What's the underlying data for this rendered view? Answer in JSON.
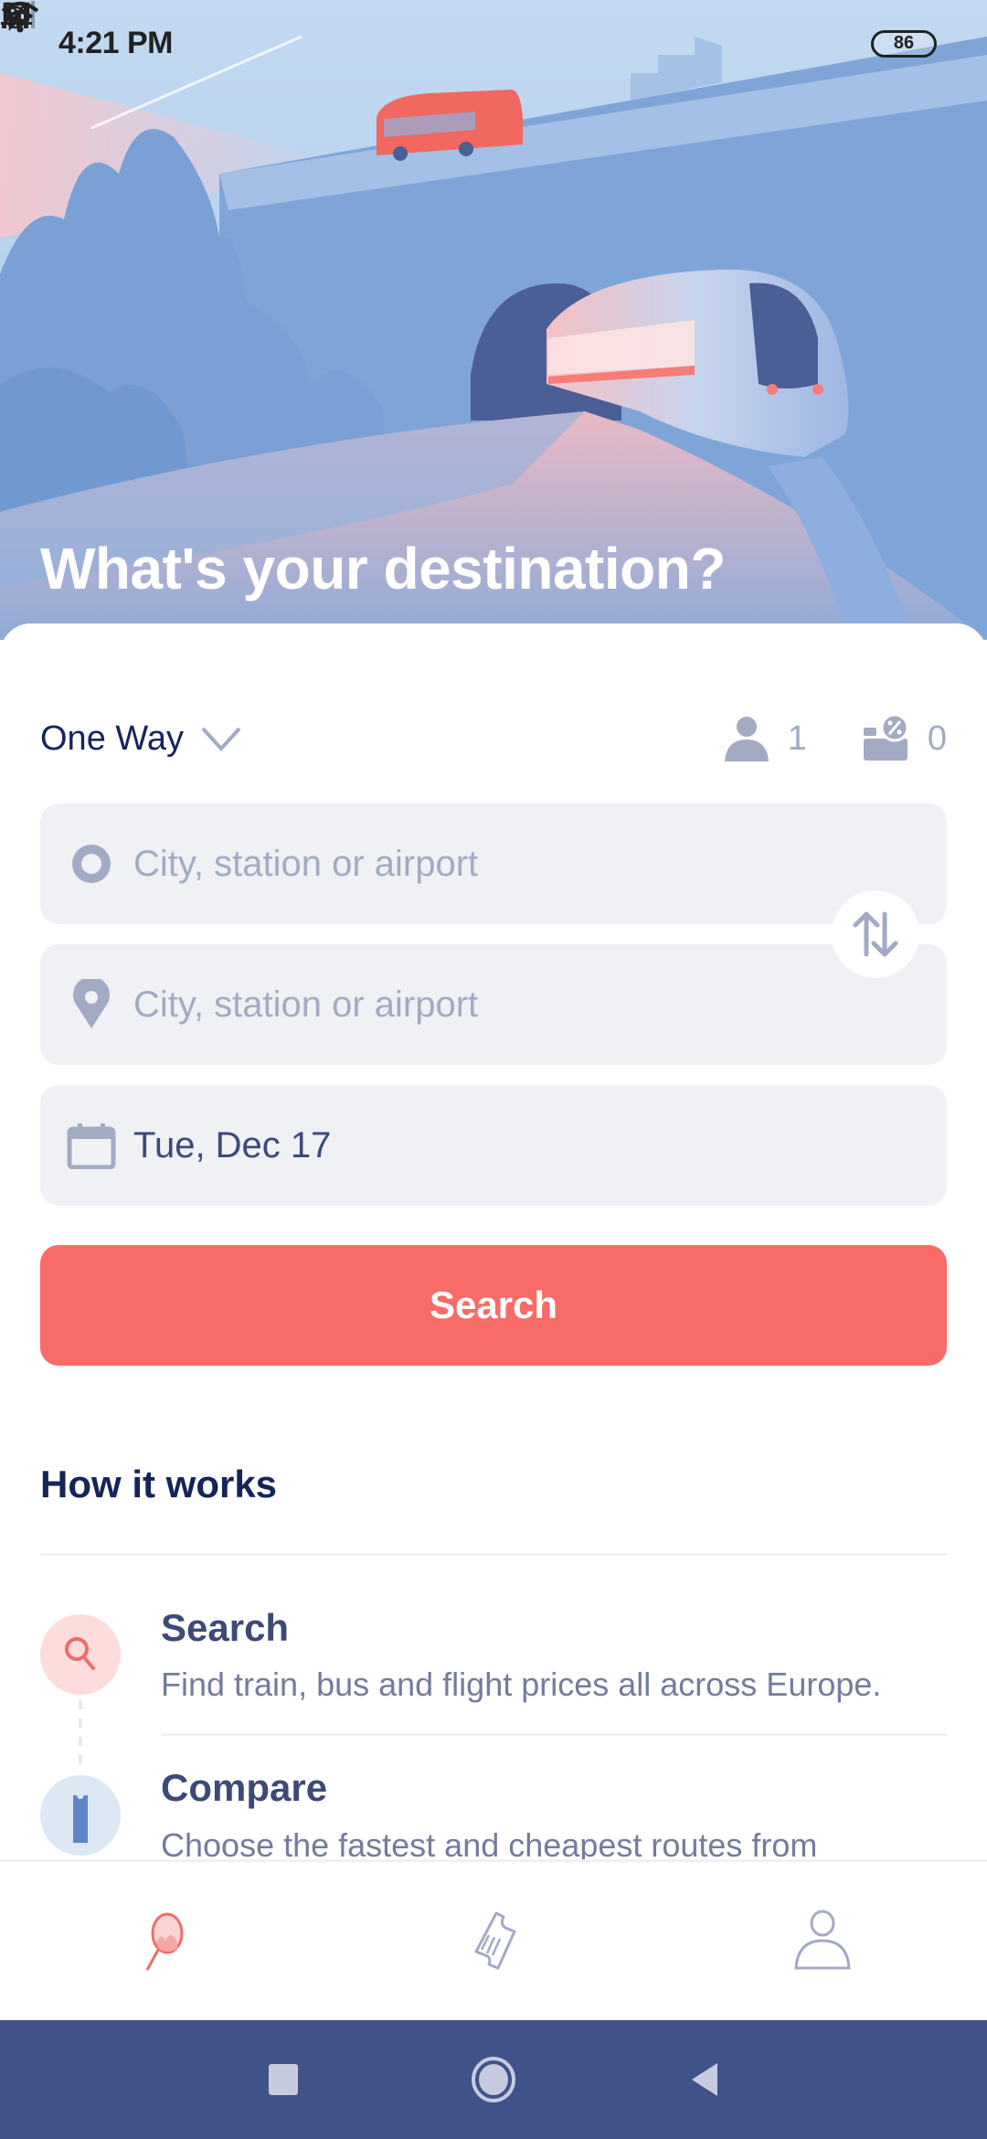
{
  "status_bar": {
    "time": "4:21 PM",
    "left_icons": [
      "alarm-icon",
      "check-notification-icon",
      "laptop-icon"
    ],
    "right_icons": [
      "bluetooth-icon",
      "signal-icon",
      "wifi-icon"
    ],
    "battery": "86"
  },
  "hero": {
    "title": "What's your destination?",
    "illustration": "train-and-bus-landscape"
  },
  "search_form": {
    "trip_type": "One Way",
    "passengers": {
      "icon": "person-icon",
      "count": "1"
    },
    "discount_cards": {
      "icon": "discount-card-icon",
      "count": "0"
    },
    "from": {
      "placeholder": "City, station or airport",
      "value": ""
    },
    "to": {
      "placeholder": "City, station or airport",
      "value": ""
    },
    "date": "Tue, Dec 17",
    "search_label": "Search"
  },
  "how_it_works": {
    "title": "How it works",
    "steps": [
      {
        "title": "Search",
        "description": "Find train, bus and flight prices all across Europe."
      },
      {
        "title": "Compare",
        "description": "Choose the fastest and cheapest routes from"
      }
    ]
  },
  "bottom_nav": {
    "items": [
      {
        "name": "search",
        "active": true
      },
      {
        "name": "tickets",
        "active": false
      },
      {
        "name": "account",
        "active": false
      }
    ]
  },
  "colors": {
    "accent": "#f96b67",
    "primary_text": "#15255a",
    "muted": "#a3aac4",
    "field_bg": "#f0f1f5",
    "system_nav": "#415288"
  }
}
